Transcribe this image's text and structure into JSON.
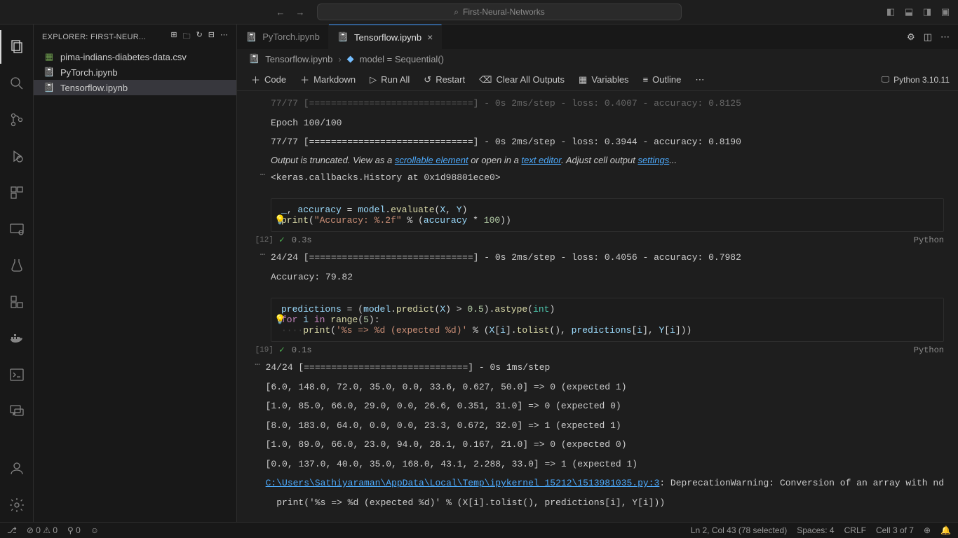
{
  "title": {
    "search": "First-Neural-Networks"
  },
  "sidebar": {
    "header": "EXPLORER: FIRST-NEUR...",
    "files": [
      {
        "name": "pima-indians-diabetes-data.csv"
      },
      {
        "name": "PyTorch.ipynb"
      },
      {
        "name": "Tensorflow.ipynb"
      }
    ]
  },
  "tabs": [
    {
      "label": "PyTorch.ipynb"
    },
    {
      "label": "Tensorflow.ipynb"
    }
  ],
  "breadcrumb": {
    "file": "Tensorflow.ipynb",
    "symbol": "model = Sequential()"
  },
  "toolbar": {
    "code": "Code",
    "markdown": "Markdown",
    "runall": "Run All",
    "restart": "Restart",
    "clear": "Clear All Outputs",
    "variables": "Variables",
    "outline": "Outline",
    "kernel": "Python 3.10.11"
  },
  "output1": {
    "line0": "77/77 [==============================] - 0s 2ms/step - loss: 0.4007 - accuracy: 0.8125",
    "line1": "Epoch 100/100",
    "line2": "77/77 [==============================] - 0s 2ms/step - loss: 0.3944 - accuracy: 0.8190",
    "trunc_a": "Output is truncated. View as a ",
    "trunc_link1": "scrollable element",
    "trunc_b": " or open in a ",
    "trunc_link2": "text editor",
    "trunc_c": ". Adjust cell output ",
    "trunc_link3": "settings",
    "trunc_d": "...",
    "history": "<keras.callbacks.History at 0x1d98801ece0>"
  },
  "cell12": {
    "index": "[12]",
    "time": "0.3s",
    "lang": "Python",
    "out1": "24/24 [==============================] - 0s 2ms/step - loss: 0.4056 - accuracy: 0.7982",
    "out2": "Accuracy: 79.82"
  },
  "cell19": {
    "index": "[19]",
    "time": "0.1s",
    "lang": "Python",
    "step": "24/24 [==============================] - 0s 1ms/step",
    "r1": "[6.0, 148.0, 72.0, 35.0, 0.0, 33.6, 0.627, 50.0] => 0 (expected 1)",
    "r2": "[1.0, 85.0, 66.0, 29.0, 0.0, 26.6, 0.351, 31.0] => 0 (expected 0)",
    "r3": "[8.0, 183.0, 64.0, 0.0, 0.0, 23.3, 0.672, 32.0] => 1 (expected 1)",
    "r4": "[1.0, 89.0, 66.0, 23.0, 94.0, 28.1, 0.167, 21.0] => 0 (expected 0)",
    "r5": "[0.0, 137.0, 40.0, 35.0, 168.0, 43.1, 2.288, 33.0] => 1 (expected 1)",
    "warn_link": "C:\\Users\\Sathiyaraman\\AppData\\Local\\Temp\\ipykernel_15212\\1513981035.py:3",
    "warn_rest": ": DeprecationWarning: Conversion of an array with nd",
    "warn_print": "  print('%s => %d (expected %d)' % (X[i].tolist(), predictions[i], Y[i]))"
  },
  "status": {
    "remote": "⎇",
    "errs": "⊘ 0 ⚠ 0",
    "ports": "⚲ 0",
    "cursor": "Ln 2, Col 43 (78 selected)",
    "spaces": "Spaces: 4",
    "eol": "CRLF",
    "cell": "Cell 3 of 7",
    "bell": "🔔"
  }
}
